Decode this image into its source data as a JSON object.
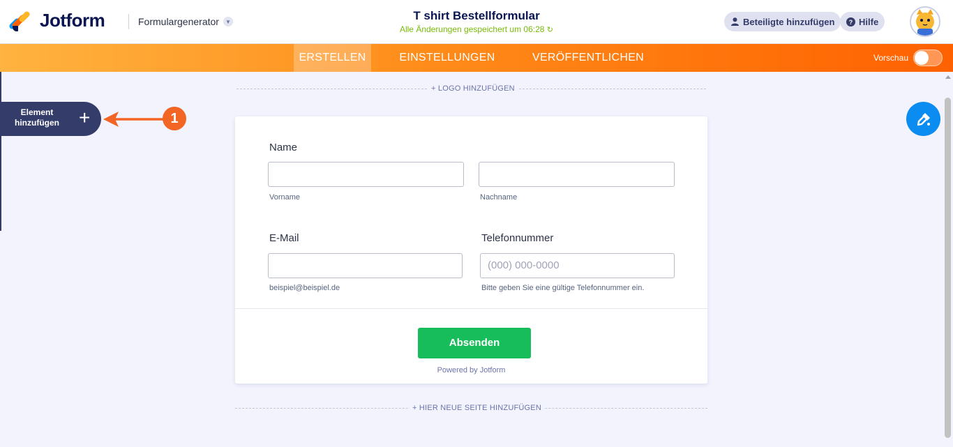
{
  "header": {
    "logo_text": "Jotform",
    "form_generator_label": "Formulargenerator",
    "form_title": "T shirt Bestellformular",
    "saved_status": "Alle Änderungen gespeichert um 06:28",
    "add_participants_label": "Beteiligte hinzufügen",
    "help_label": "Hilfe"
  },
  "nav": {
    "tabs": [
      {
        "label": "ERSTELLEN",
        "active": true
      },
      {
        "label": "EINSTELLUNGEN",
        "active": false
      },
      {
        "label": "VERÖFFENTLICHEN",
        "active": false
      }
    ],
    "preview_label": "Vorschau"
  },
  "workspace": {
    "add_logo_label": "+ LOGO HINZUFÜGEN",
    "add_element_label": "Element hinzufügen",
    "add_element_plus": "+",
    "annotation_number": "1",
    "add_page_label": "+ HIER NEUE SEITE HINZUFÜGEN"
  },
  "form": {
    "name_label": "Name",
    "first_name_sub": "Vorname",
    "last_name_sub": "Nachname",
    "email_label": "E-Mail",
    "email_sub": "beispiel@beispiel.de",
    "phone_label": "Telefonnummer",
    "phone_placeholder": "(000) 000-0000",
    "phone_sub": "Bitte geben Sie eine gültige Telefonnummer ein.",
    "submit_label": "Absenden",
    "powered_by": "Powered by Jotform"
  },
  "colors": {
    "brand_navy": "#0a1551",
    "orange_accent": "#ff6100",
    "submit_green": "#18bd5b",
    "saved_green": "#78bb07",
    "paint_blue": "#0a8cf0"
  }
}
